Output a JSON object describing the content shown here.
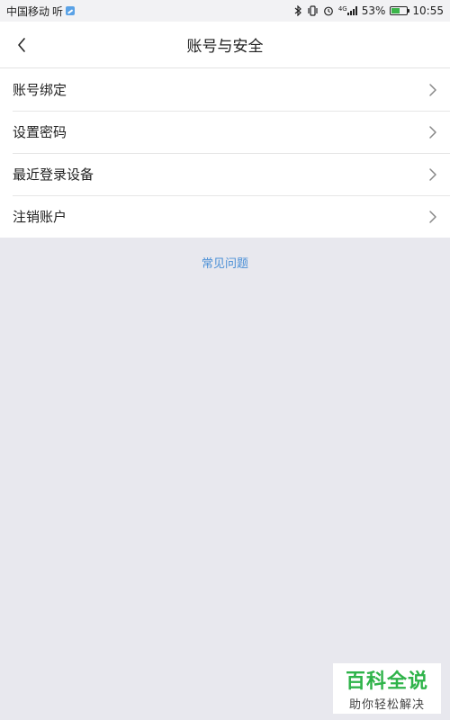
{
  "status_bar": {
    "carrier": "中国移动",
    "carrier_suffix": "听",
    "battery_percent_text": "53%",
    "battery_level": 0.53,
    "time": "10:55",
    "network_type": "4G",
    "icons": [
      "bluetooth-icon",
      "vibrate-icon",
      "alarm-icon",
      "signal-icon",
      "battery-icon"
    ]
  },
  "header": {
    "title": "账号与安全",
    "back_icon": "chevron-left-icon"
  },
  "menu": {
    "items": [
      {
        "label": "账号绑定"
      },
      {
        "label": "设置密码"
      },
      {
        "label": "最近登录设备"
      },
      {
        "label": "注销账户"
      }
    ]
  },
  "faq": {
    "label": "常见问题"
  },
  "watermark": {
    "title": "百科全说",
    "subtitle": "助你轻松解决"
  },
  "colors": {
    "background": "#e8e8ee",
    "link": "#4a8fd6",
    "watermark_green": "#2fb34a",
    "battery_green": "#3bb54a"
  }
}
